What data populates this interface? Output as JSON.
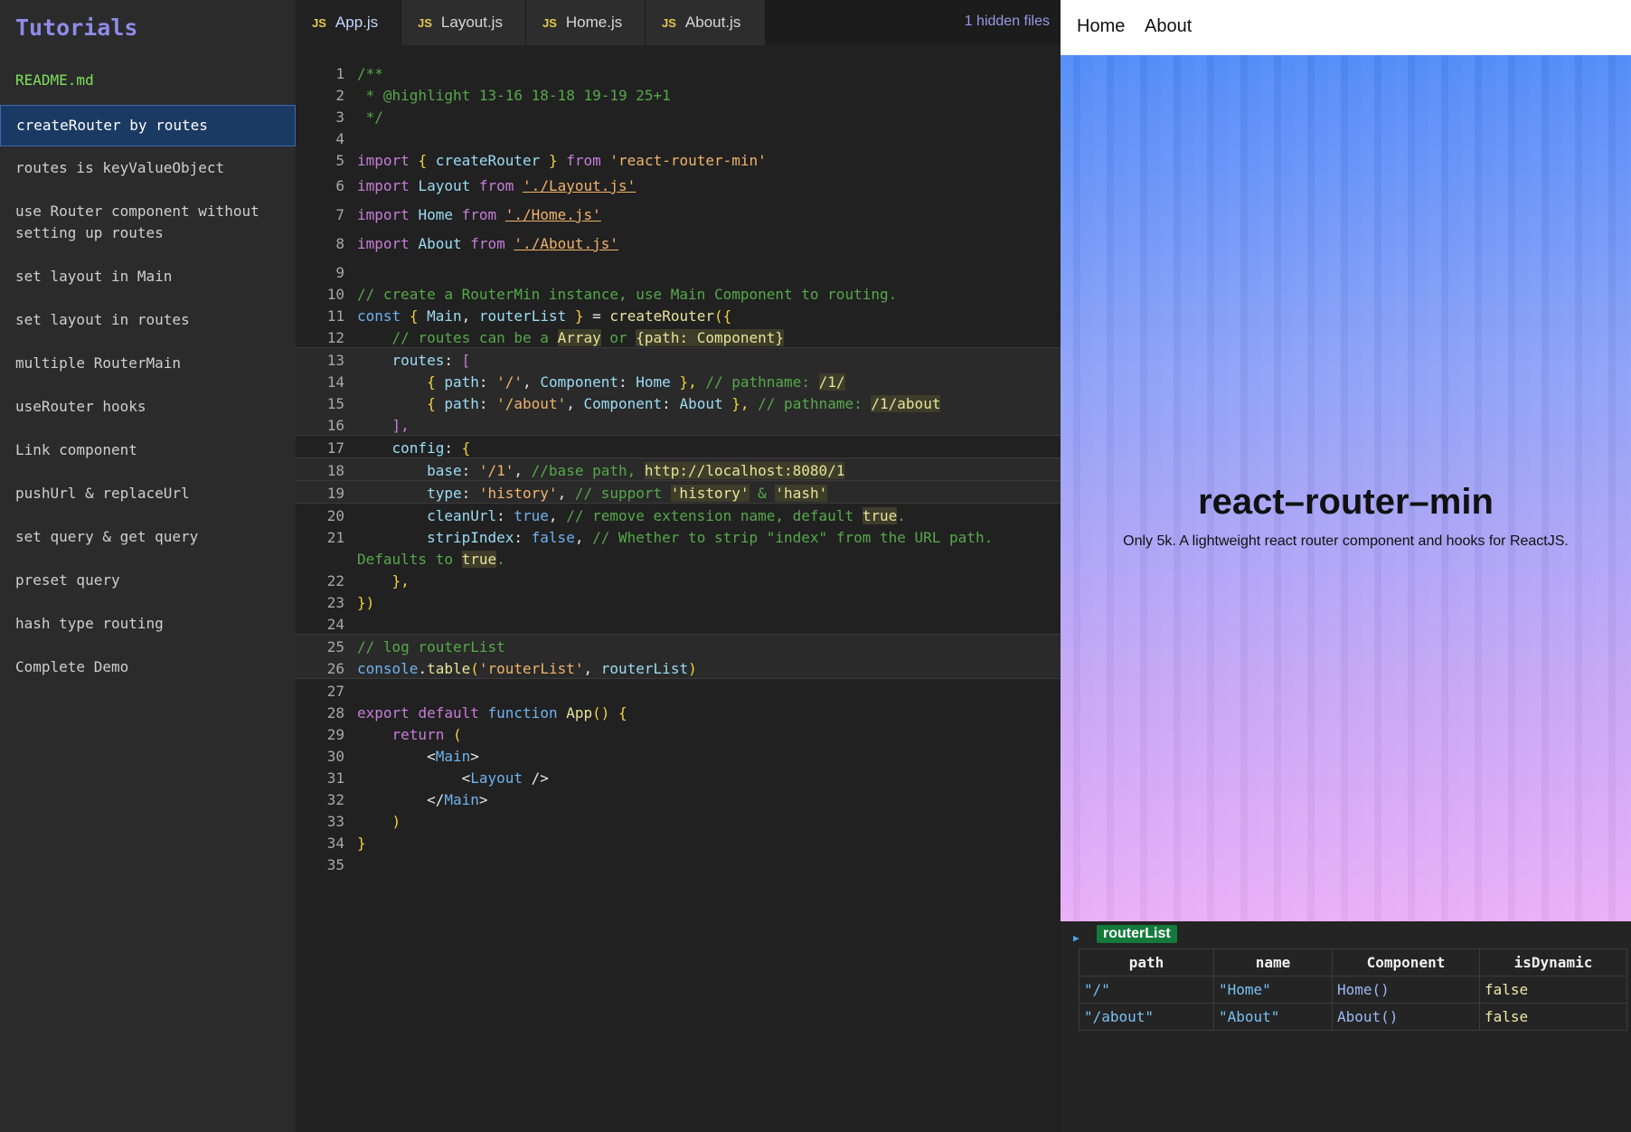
{
  "sidebar": {
    "title": "Tutorials",
    "readme": "README.md",
    "items": [
      {
        "label": "createRouter by routes",
        "active": true
      },
      {
        "label": "routes is keyValueObject"
      },
      {
        "label": "use Router component without\nsetting up routes"
      },
      {
        "label": "set layout in Main"
      },
      {
        "label": "set layout in routes"
      },
      {
        "label": "multiple RouterMain"
      },
      {
        "label": "useRouter hooks"
      },
      {
        "label": "Link component"
      },
      {
        "label": "pushUrl & replaceUrl"
      },
      {
        "label": "set query & get query"
      },
      {
        "label": "preset query"
      },
      {
        "label": "hash type routing"
      },
      {
        "label": "Complete Demo"
      }
    ]
  },
  "editor": {
    "tabs": [
      {
        "badge": "JS",
        "label": "App.js",
        "active": true
      },
      {
        "badge": "JS",
        "label": "Layout.js"
      },
      {
        "badge": "JS",
        "label": "Home.js"
      },
      {
        "badge": "JS",
        "label": "About.js"
      }
    ],
    "hidden_files": "1 hidden files",
    "line_numbers": [
      "1",
      "2",
      "3",
      "4",
      "5",
      "6",
      "7",
      "8",
      "9",
      "10",
      "11",
      "12",
      "13",
      "14",
      "15",
      "16",
      "17",
      "18",
      "19",
      "20",
      "21",
      "22",
      "23",
      "24",
      "25",
      "26",
      "27",
      "28",
      "29",
      "30",
      "31",
      "32",
      "33",
      "34",
      "35"
    ],
    "code": {
      "l1": "/**",
      "l2": " * @highlight 13-16 18-18 19-19 25+1",
      "l3": " */",
      "l5a": "import",
      "l5b": "{",
      "l5c": "createRouter",
      "l5d": "}",
      "l5e": "from",
      "l5f": "'react-router-min'",
      "l6a": "import",
      "l6b": "Layout",
      "l6c": "from",
      "l6d": "'./Layout.js'",
      "l7a": "import",
      "l7b": "Home",
      "l7c": "from",
      "l7d": "'./Home.js'",
      "l8a": "import",
      "l8b": "About",
      "l8c": "from",
      "l8d": "'./About.js'",
      "l10": "// create a RouterMin instance, use Main Component to routing.",
      "l11a": "const",
      "l11b": "{",
      "l11c": "Main",
      "l11d": "routerList",
      "l11e": "}",
      "l11f": "=",
      "l11g": "createRouter",
      "l11h": "({",
      "l12a": "// routes can be a",
      "l12b": "Array",
      "l12c": "or",
      "l12d": "{path: Component}",
      "l13a": "routes",
      "l13b": "[",
      "l14a": "{",
      "l14b": "path",
      "l14c": "'/'",
      "l14d": "Component",
      "l14e": "Home",
      "l14f": "},",
      "l14g": "// pathname:",
      "l14h": "/1/",
      "l15a": "{",
      "l15b": "path",
      "l15c": "'/about'",
      "l15d": "Component",
      "l15e": "About",
      "l15f": "},",
      "l15g": "// pathname:",
      "l15h": "/1/about",
      "l16": "],",
      "l17a": "config",
      "l17b": "{",
      "l18a": "base",
      "l18b": "'/1'",
      "l18c": "//base path,",
      "l18d": "http://localhost:8080/1",
      "l19a": "type",
      "l19b": "'history'",
      "l19c": "// support",
      "l19d": "'history'",
      "l19e": "&",
      "l19f": "'hash'",
      "l20a": "cleanUrl",
      "l20b": "true",
      "l20c": "// remove extension name, default",
      "l20d": "true",
      "l20e": ".",
      "l21a": "stripIndex",
      "l21b": "false",
      "l21c": "// Whether to strip \"index\" from the URL path.",
      "l21d": "Defaults to",
      "l21e": "true",
      "l21f": ".",
      "l22": "},",
      "l23": "})",
      "l25": "// log routerList",
      "l26a": "console",
      "l26b": "table",
      "l26c": "'routerList'",
      "l26d": "routerList",
      "l28a": "export",
      "l28b": "default",
      "l28c": "function",
      "l28d": "App",
      "l28e": "() {",
      "l29a": "return",
      "l29b": "(",
      "l30": "Main",
      "l31": "Layout",
      "l32": "Main",
      "l33": ")",
      "l34": "}"
    }
  },
  "preview": {
    "nav": [
      "Home",
      "About"
    ],
    "title": "react–router–min",
    "subtitle": "Only 5k. A lightweight react router component and hooks for ReactJS.",
    "console": {
      "label": "routerList",
      "headers": [
        "path",
        "name",
        "Component",
        "isDynamic"
      ],
      "rows": [
        [
          "\"/\"",
          "\"Home\"",
          "Home()",
          "false"
        ],
        [
          "\"/about\"",
          "\"About\"",
          "About()",
          "false"
        ]
      ]
    }
  }
}
